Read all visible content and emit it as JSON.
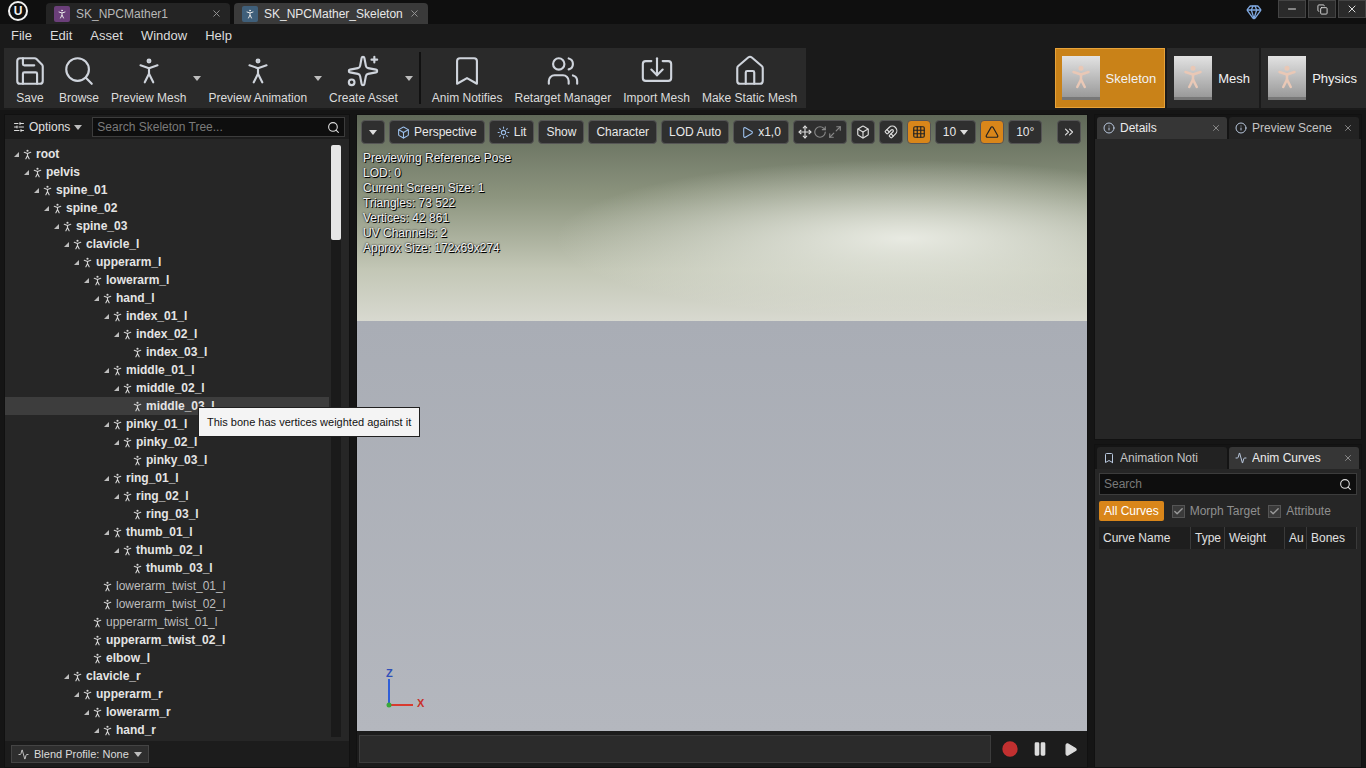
{
  "window": {
    "logo": "U",
    "tabs": [
      {
        "label": "SK_NPCMather1",
        "selected": false
      },
      {
        "label": "SK_NPCMather_Skeleton",
        "selected": true
      }
    ]
  },
  "menu": [
    "File",
    "Edit",
    "Asset",
    "Window",
    "Help"
  ],
  "toolbar": {
    "asset_buttons": [
      {
        "label": "Save",
        "kind": "save",
        "dropdown": false
      },
      {
        "label": "Browse",
        "kind": "browse",
        "dropdown": false
      },
      {
        "label": "Preview Mesh",
        "kind": "mesh",
        "dropdown": true
      },
      {
        "label": "Preview Animation",
        "kind": "anim",
        "dropdown": true
      },
      {
        "label": "Create Asset",
        "kind": "create",
        "dropdown": true
      }
    ],
    "tool_buttons": [
      {
        "label": "Anim Notifies",
        "kind": "notifies",
        "dropdown": false
      },
      {
        "label": "Retarget Manager",
        "kind": "retarget",
        "dropdown": false
      },
      {
        "label": "Import Mesh",
        "kind": "import",
        "dropdown": false
      },
      {
        "label": "Make Static Mesh",
        "kind": "static",
        "dropdown": false
      }
    ],
    "modes": [
      {
        "label": "Skeleton",
        "selected": true
      },
      {
        "label": "Mesh",
        "selected": false
      },
      {
        "label": "Physics",
        "selected": false
      }
    ]
  },
  "skeleton_tree": {
    "options": "Options",
    "search_placeholder": "Search Skeleton Tree...",
    "scroll_level": 0.16,
    "blend_profile": "Blend Profile: None",
    "bones": [
      {
        "name": "root",
        "depth": 0,
        "children": true,
        "expanded": true,
        "weighted": true,
        "highlighted": false
      },
      {
        "name": "pelvis",
        "depth": 1,
        "children": true,
        "expanded": true,
        "weighted": true,
        "highlighted": false
      },
      {
        "name": "spine_01",
        "depth": 2,
        "children": true,
        "expanded": true,
        "weighted": true,
        "highlighted": false
      },
      {
        "name": "spine_02",
        "depth": 3,
        "children": true,
        "expanded": true,
        "weighted": true,
        "highlighted": false
      },
      {
        "name": "spine_03",
        "depth": 4,
        "children": true,
        "expanded": true,
        "weighted": true,
        "highlighted": false
      },
      {
        "name": "clavicle_l",
        "depth": 5,
        "children": true,
        "expanded": true,
        "weighted": true,
        "highlighted": false
      },
      {
        "name": "upperarm_l",
        "depth": 6,
        "children": true,
        "expanded": true,
        "weighted": true,
        "highlighted": false
      },
      {
        "name": "lowerarm_l",
        "depth": 7,
        "children": true,
        "expanded": true,
        "weighted": true,
        "highlighted": false
      },
      {
        "name": "hand_l",
        "depth": 8,
        "children": true,
        "expanded": true,
        "weighted": true,
        "highlighted": false
      },
      {
        "name": "index_01_l",
        "depth": 9,
        "children": true,
        "expanded": true,
        "weighted": true,
        "highlighted": false
      },
      {
        "name": "index_02_l",
        "depth": 10,
        "children": true,
        "expanded": true,
        "weighted": true,
        "highlighted": false
      },
      {
        "name": "index_03_l",
        "depth": 11,
        "children": false,
        "expanded": false,
        "weighted": true,
        "highlighted": false
      },
      {
        "name": "middle_01_l",
        "depth": 9,
        "children": true,
        "expanded": true,
        "weighted": true,
        "highlighted": false
      },
      {
        "name": "middle_02_l",
        "depth": 10,
        "children": true,
        "expanded": true,
        "weighted": true,
        "highlighted": false
      },
      {
        "name": "middle_03_l",
        "depth": 11,
        "children": false,
        "expanded": false,
        "weighted": true,
        "highlighted": true
      },
      {
        "name": "pinky_01_l",
        "depth": 9,
        "children": true,
        "expanded": true,
        "weighted": true,
        "highlighted": false
      },
      {
        "name": "pinky_02_l",
        "depth": 10,
        "children": true,
        "expanded": true,
        "weighted": true,
        "highlighted": false
      },
      {
        "name": "pinky_03_l",
        "depth": 11,
        "children": false,
        "expanded": false,
        "weighted": true,
        "highlighted": false
      },
      {
        "name": "ring_01_l",
        "depth": 9,
        "children": true,
        "expanded": true,
        "weighted": true,
        "highlighted": false
      },
      {
        "name": "ring_02_l",
        "depth": 10,
        "children": true,
        "expanded": true,
        "weighted": true,
        "highlighted": false
      },
      {
        "name": "ring_03_l",
        "depth": 11,
        "children": false,
        "expanded": false,
        "weighted": true,
        "highlighted": false
      },
      {
        "name": "thumb_01_l",
        "depth": 9,
        "children": true,
        "expanded": true,
        "weighted": true,
        "highlighted": false
      },
      {
        "name": "thumb_02_l",
        "depth": 10,
        "children": true,
        "expanded": true,
        "weighted": true,
        "highlighted": false
      },
      {
        "name": "thumb_03_l",
        "depth": 11,
        "children": false,
        "expanded": false,
        "weighted": true,
        "highlighted": false
      },
      {
        "name": "lowerarm_twist_01_l",
        "depth": 8,
        "children": false,
        "expanded": false,
        "weighted": false,
        "highlighted": false
      },
      {
        "name": "lowerarm_twist_02_l",
        "depth": 8,
        "children": false,
        "expanded": false,
        "weighted": false,
        "highlighted": false
      },
      {
        "name": "upperarm_twist_01_l",
        "depth": 7,
        "children": false,
        "expanded": false,
        "weighted": false,
        "highlighted": false
      },
      {
        "name": "upperarm_twist_02_l",
        "depth": 7,
        "children": false,
        "expanded": false,
        "weighted": true,
        "highlighted": false
      },
      {
        "name": "elbow_l",
        "depth": 7,
        "children": false,
        "expanded": false,
        "weighted": true,
        "highlighted": false
      },
      {
        "name": "clavicle_r",
        "depth": 5,
        "children": true,
        "expanded": true,
        "weighted": true,
        "highlighted": false
      },
      {
        "name": "upperarm_r",
        "depth": 6,
        "children": true,
        "expanded": true,
        "weighted": true,
        "highlighted": false
      },
      {
        "name": "lowerarm_r",
        "depth": 7,
        "children": true,
        "expanded": true,
        "weighted": true,
        "highlighted": false
      },
      {
        "name": "hand_r",
        "depth": 8,
        "children": true,
        "expanded": true,
        "weighted": true,
        "highlighted": false
      }
    ]
  },
  "tooltip": {
    "text": "This bone has vertices weighted against it"
  },
  "viewport": {
    "buttons": [
      {
        "label": "Perspective",
        "kind": "perspective"
      },
      {
        "label": "Lit",
        "kind": "lit"
      },
      {
        "label": "Show",
        "kind": "plain"
      },
      {
        "label": "Character",
        "kind": "plain"
      },
      {
        "label": "LOD Auto",
        "kind": "plain"
      },
      {
        "label": "x1,0",
        "kind": "speed"
      }
    ],
    "grid_snap": {
      "value": "10",
      "on": true
    },
    "rotate_snap": {
      "value": "10°",
      "on": true
    },
    "stats": [
      "Previewing Reference Pose",
      "LOD: 0",
      "Current Screen Size: 1",
      "Triangles: 73 522",
      "Vertices: 42 861",
      "UV Channels: 2",
      "Approx Size: 172x69x274"
    ],
    "axes": {
      "up": "Z",
      "right": "X"
    }
  },
  "details_panel": {
    "tabs": [
      {
        "label": "Details",
        "selected": true
      },
      {
        "label": "Preview Scene",
        "selected": false
      }
    ]
  },
  "curves_panel": {
    "tabs": [
      {
        "label": "Animation Noti",
        "selected": false
      },
      {
        "label": "Anim Curves",
        "selected": true
      }
    ],
    "search_placeholder": "Search",
    "all_button": {
      "label": "All Curves",
      "selected": true
    },
    "filters": [
      {
        "label": "Morph Target",
        "checked": true
      },
      {
        "label": "Attribute",
        "checked": true
      }
    ],
    "columns": [
      "Curve Name",
      "Type",
      "Weight",
      "Au",
      "Bones"
    ]
  }
}
